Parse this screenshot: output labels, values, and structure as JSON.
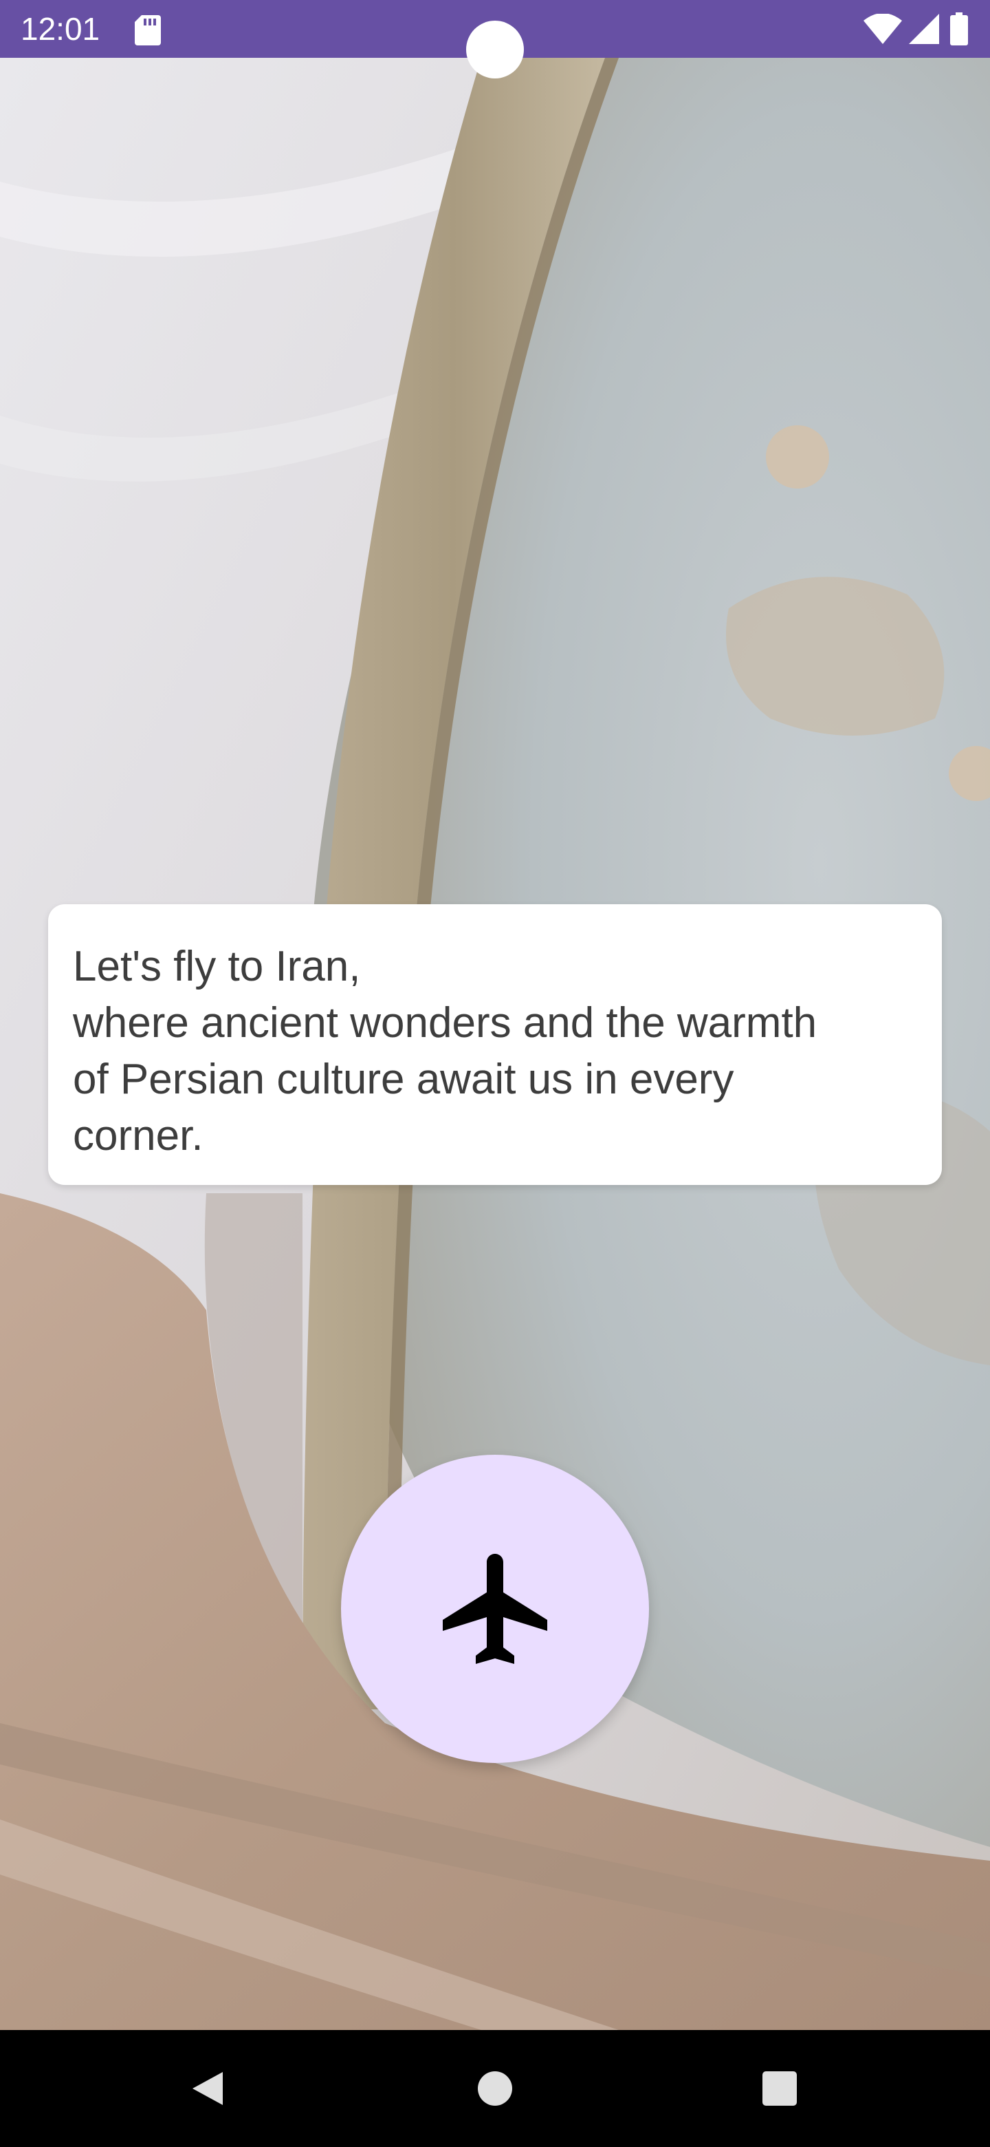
{
  "status_bar": {
    "time": "12:01",
    "icons": [
      "sd-card-icon",
      "wifi-icon",
      "cellular-signal-icon",
      "battery-icon"
    ],
    "background_color": "#6750a4"
  },
  "background": {
    "description_icon": "globe-photo"
  },
  "message_card": {
    "lines": [
      "Let's fly to Iran,",
      "where ancient wonders and the warmth",
      "of Persian culture await us in every",
      "corner."
    ]
  },
  "fly_button": {
    "icon": "airplane-icon",
    "background_color": "#eaddff"
  },
  "nav_bar": {
    "buttons": [
      "back-icon",
      "home-icon",
      "recents-icon"
    ]
  }
}
